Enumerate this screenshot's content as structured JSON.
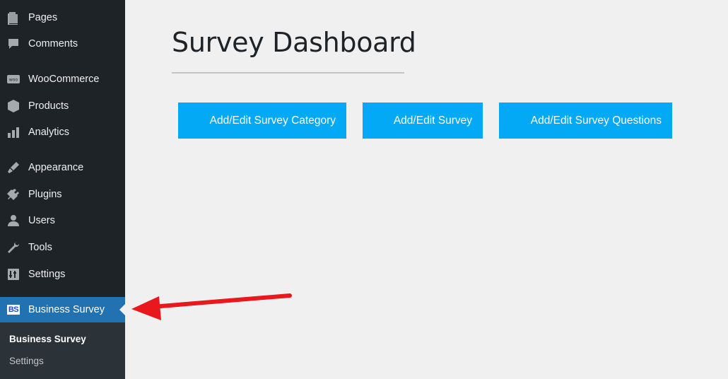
{
  "sidebar": {
    "items": [
      {
        "label": "Pages",
        "icon": "pages-icon"
      },
      {
        "label": "Comments",
        "icon": "comments-icon"
      },
      {
        "label": "WooCommerce",
        "icon": "woocommerce-icon"
      },
      {
        "label": "Products",
        "icon": "products-icon"
      },
      {
        "label": "Analytics",
        "icon": "analytics-icon"
      },
      {
        "label": "Appearance",
        "icon": "appearance-icon"
      },
      {
        "label": "Plugins",
        "icon": "plugins-icon"
      },
      {
        "label": "Users",
        "icon": "users-icon"
      },
      {
        "label": "Tools",
        "icon": "tools-icon"
      },
      {
        "label": "Settings",
        "icon": "settings-icon"
      },
      {
        "label": "Business Survey",
        "icon": "business-survey-logo-icon",
        "logo_text": "BS"
      }
    ],
    "submenu": [
      {
        "label": "Business Survey"
      },
      {
        "label": "Settings"
      }
    ]
  },
  "main": {
    "title": "Survey Dashboard",
    "buttons": [
      {
        "label": "Add/Edit Survey Category"
      },
      {
        "label": "Add/Edit Survey"
      },
      {
        "label": "Add/Edit Survey Questions"
      }
    ]
  },
  "colors": {
    "sidebar_bg": "#1d2327",
    "active_bg": "#2271b1",
    "button_bg": "#03a9f4",
    "annotation_arrow": "#e8181c"
  }
}
